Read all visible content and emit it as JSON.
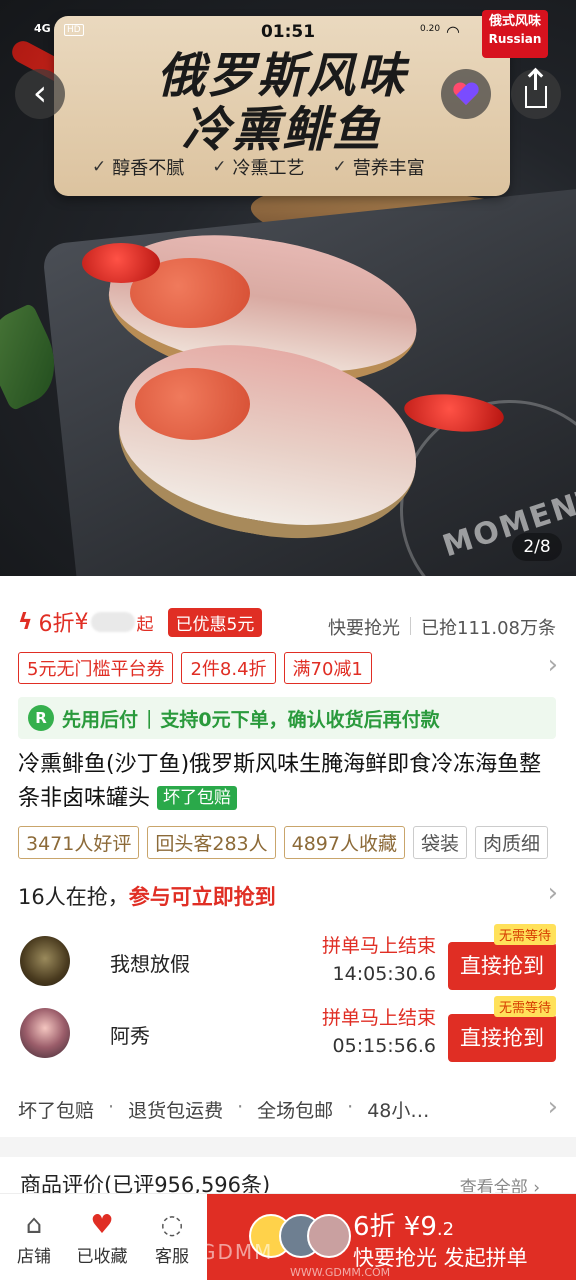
{
  "status_bar": {
    "signal": "4G",
    "hd": "HD",
    "time": "01:51",
    "net_speed": "0.20"
  },
  "hero": {
    "banner_line1": "俄罗斯风味",
    "banner_line2": "冷熏鲱鱼",
    "features": [
      "醇香不腻",
      "冷熏工艺",
      "营养丰富"
    ],
    "badge_cn": "俄式风味",
    "badge_en": "Russian",
    "stamp": "MOMENT",
    "image_counter": "2/8"
  },
  "price": {
    "discount": "6折",
    "currency": "¥",
    "qi": "起",
    "promo": "已优惠5元",
    "hint": "快要抢光",
    "sold": "已抢111.08万条"
  },
  "coupons": [
    "5元无门槛平台券",
    "2件8.4折",
    "满70减1"
  ],
  "paylater": {
    "icon": "R",
    "label": "先用后付",
    "sep": "|",
    "text": "支持0元下单，确认收货后再付款"
  },
  "product": {
    "title": "冷熏鲱鱼(沙丁鱼)俄罗斯风味生腌海鲜即食冷冻海鱼整条非卤味罐头",
    "guarantee_tag": "坏了包赔"
  },
  "tags": [
    "3471人好评",
    "回头客283人",
    "4897人收藏",
    "袋装",
    "肉质细"
  ],
  "grab": {
    "prefix": "16人在抢，",
    "highlight": "参与可立即抢到"
  },
  "group_buys": [
    {
      "name": "我想放假",
      "status": "拼单马上结束",
      "timer": "14:05:30.6",
      "button": "直接抢到",
      "badge": "无需等待"
    },
    {
      "name": "阿秀",
      "status": "拼单马上结束",
      "timer": "05:15:56.6",
      "button": "直接抢到",
      "badge": "无需等待"
    }
  ],
  "services": [
    "坏了包赔",
    "退货包运费",
    "全场包邮",
    "48小…"
  ],
  "reviews": {
    "title": "商品评价(已评956,596条)",
    "view_all": "查看全部"
  },
  "bottom_nav": {
    "shop": "店铺",
    "favorite": "已收藏",
    "service": "客服",
    "buy_price_main": "6折 ¥9",
    "buy_price_decimal": ".2",
    "buy_label": "快要抢光 发起拼单"
  },
  "watermark": {
    "brand": "GDMM",
    "url": "WWW.GDMM.COM"
  },
  "colors": {
    "accent": "#e02e24",
    "green": "#2aa94a",
    "tag_gold": "#c9a56b"
  }
}
